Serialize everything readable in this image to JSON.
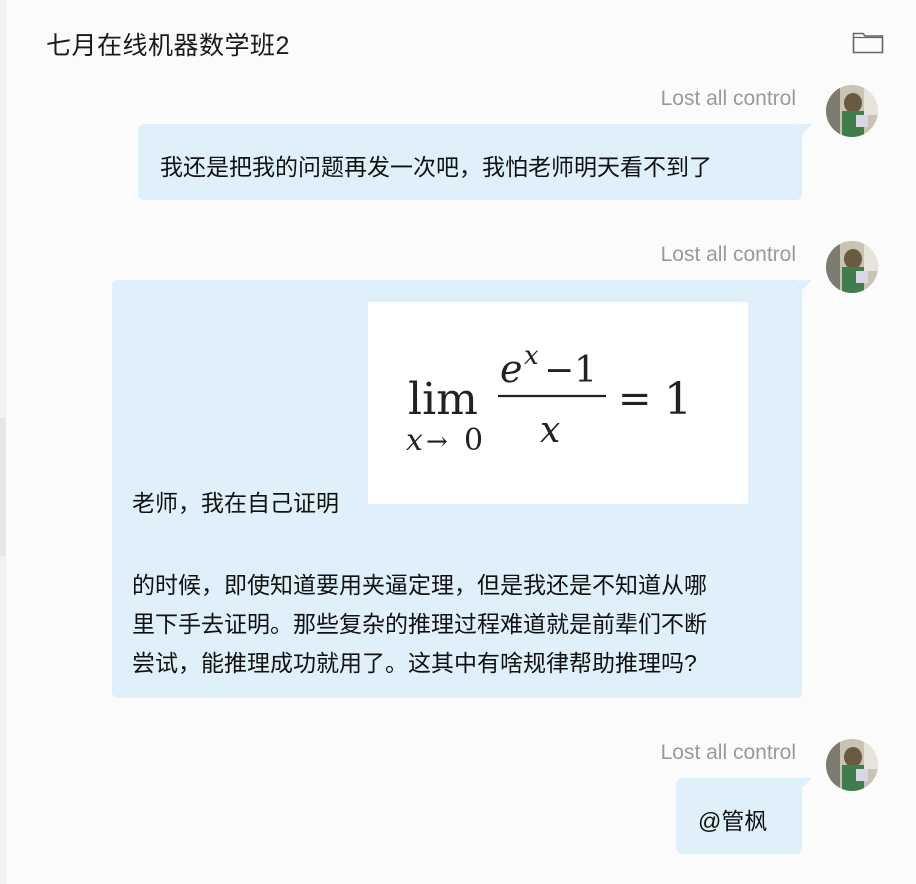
{
  "header": {
    "title": "七月在线机器数学班2",
    "folder_icon": "folder-icon"
  },
  "messages": [
    {
      "sender": "Lost all control",
      "lines": [
        "我还是把我的问题再发一次吧，我怕老师明天看不到了"
      ]
    },
    {
      "sender": "Lost all control",
      "prefix": "老师，我在自己证明",
      "formula": {
        "lim": "lim",
        "sub_var": "x",
        "sub_arrow": "→",
        "sub_val": "0",
        "num_base": "e",
        "num_exp": "x",
        "num_rest": "−1",
        "den": "x",
        "equals": "=",
        "rhs": "1"
      },
      "lines": [
        "的时候，即使知道要用夹逼定理，但是我还是不知道从哪",
        "里下手去证明。那些复杂的推理过程难道就是前辈们不断",
        "尝试，能推理成功就用了。这其中有啥规律帮助推理吗?"
      ]
    },
    {
      "sender": "Lost all control",
      "lines": [
        "@管枫"
      ]
    }
  ],
  "colors": {
    "bubble": "#dff0fb",
    "sender": "#9a9a9a",
    "background": "#fbfbfb"
  }
}
